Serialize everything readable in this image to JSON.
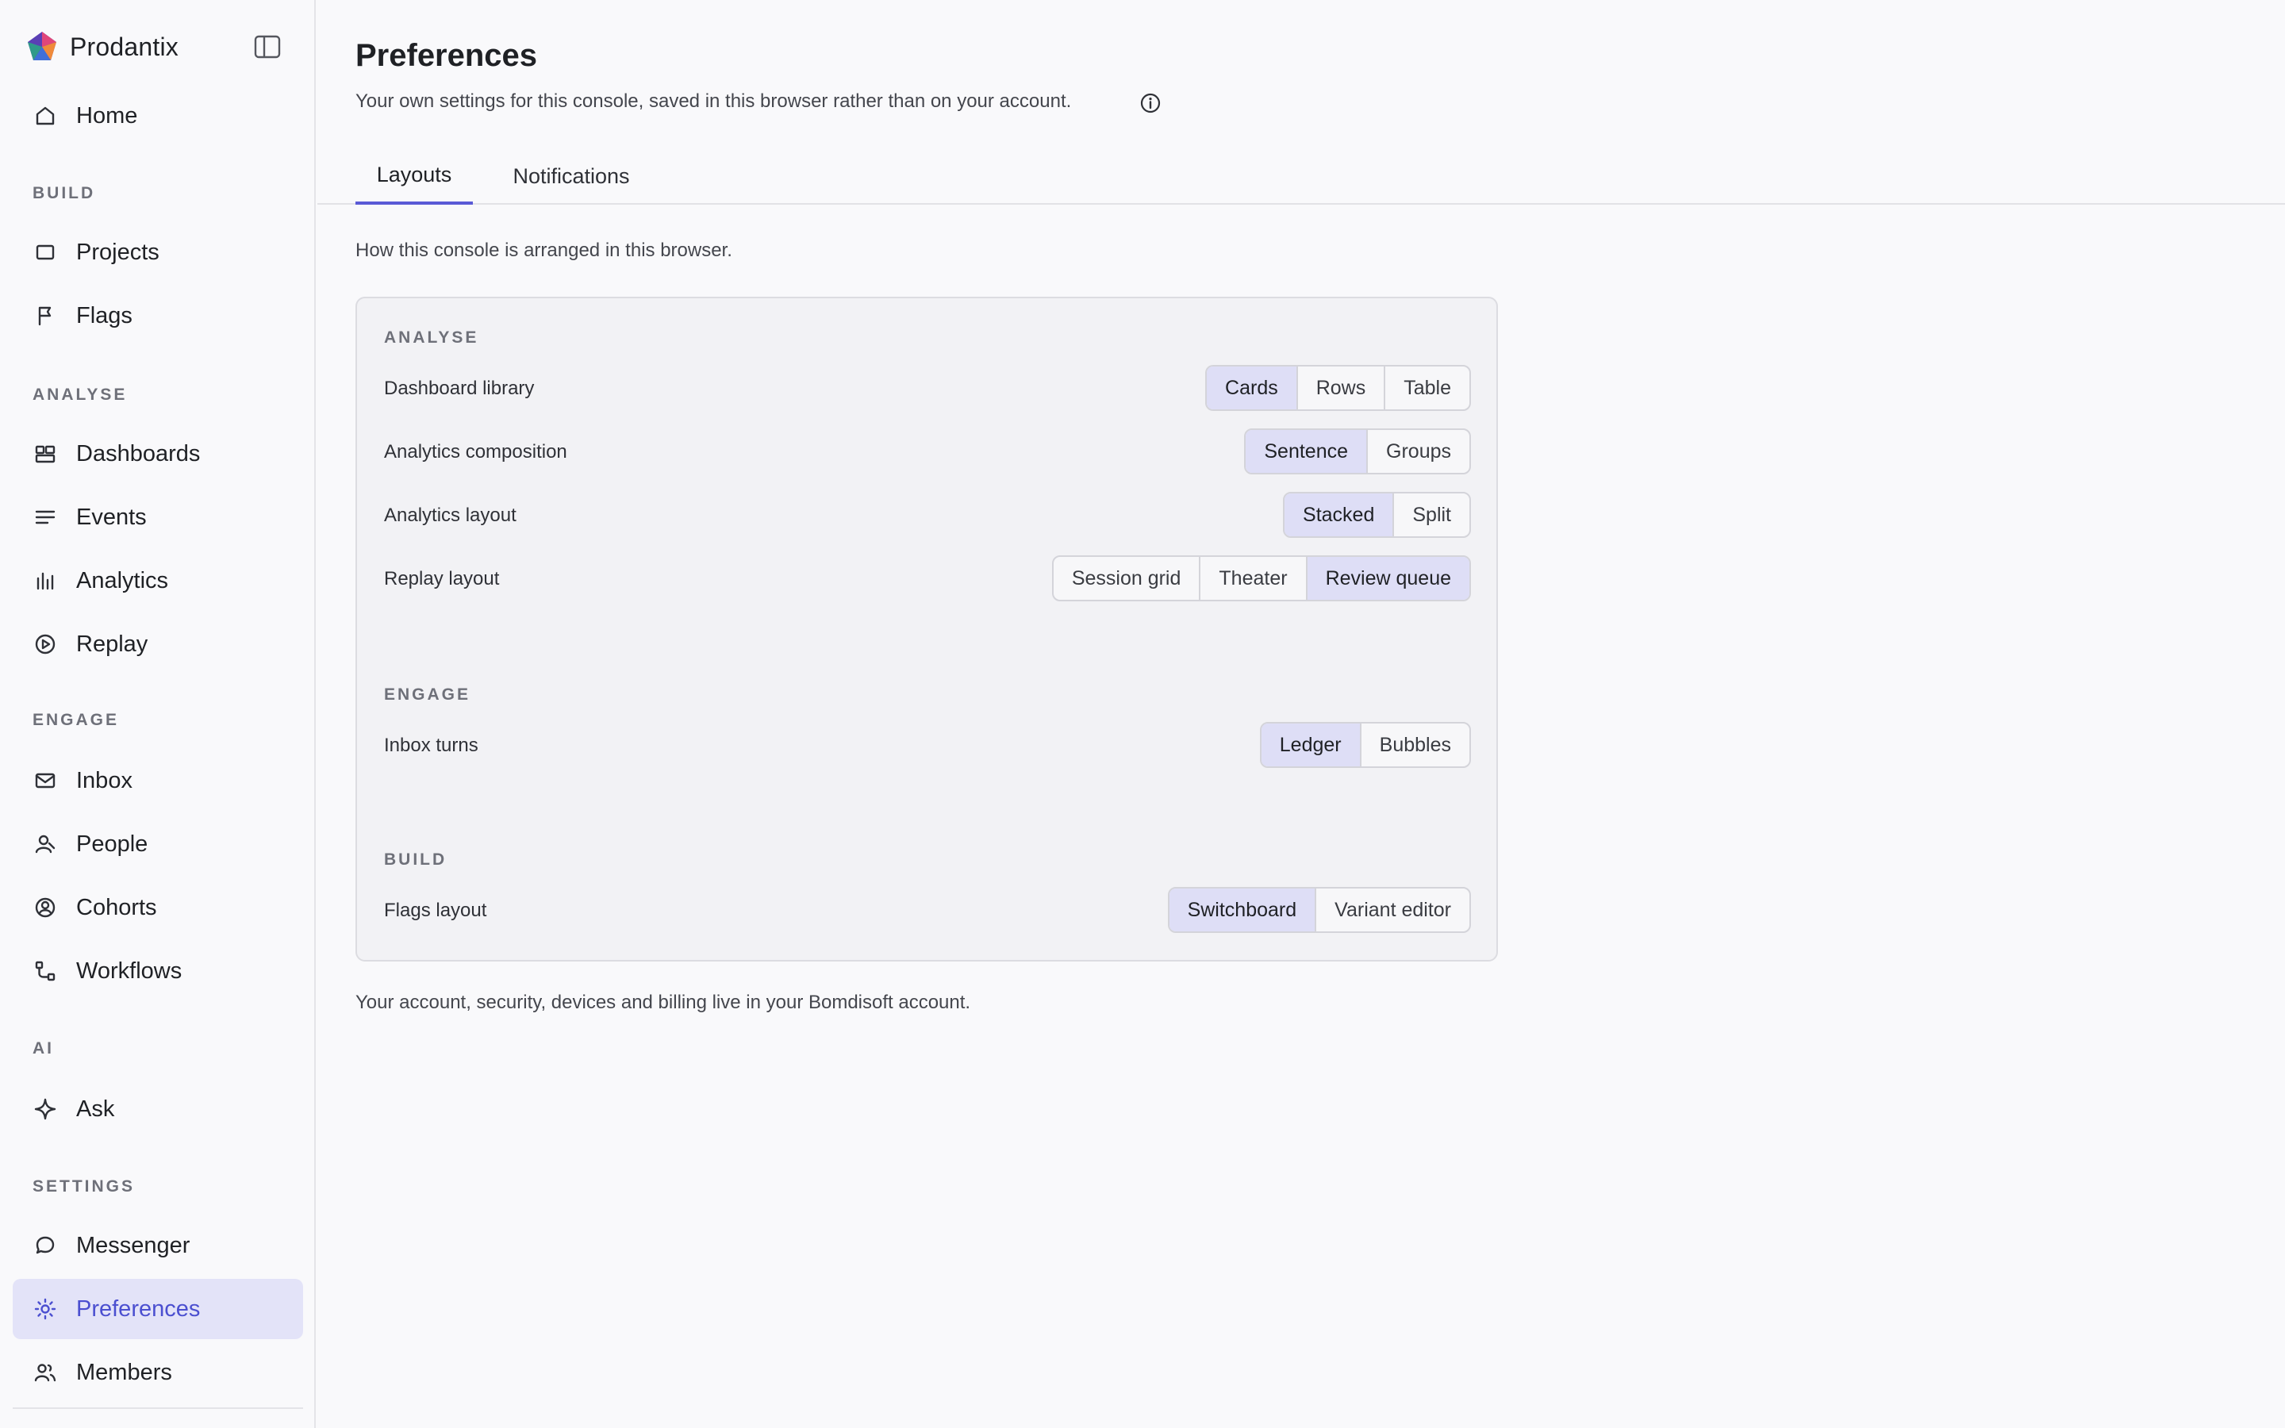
{
  "brand": {
    "name": "Prodantix"
  },
  "sidebar": {
    "home": {
      "label": "Home",
      "icon": "home-icon"
    },
    "sections": [
      {
        "label": "BUILD",
        "items": [
          {
            "label": "Projects",
            "icon": "square-icon"
          },
          {
            "label": "Flags",
            "icon": "flag-icon"
          }
        ]
      },
      {
        "label": "ANALYSE",
        "items": [
          {
            "label": "Dashboards",
            "icon": "dashboard-icon"
          },
          {
            "label": "Events",
            "icon": "list-lines-icon"
          },
          {
            "label": "Analytics",
            "icon": "bar-chart-icon"
          },
          {
            "label": "Replay",
            "icon": "play-circle-icon"
          }
        ]
      },
      {
        "label": "ENGAGE",
        "items": [
          {
            "label": "Inbox",
            "icon": "mail-icon"
          },
          {
            "label": "People",
            "icon": "person-icon"
          },
          {
            "label": "Cohorts",
            "icon": "cohort-icon"
          },
          {
            "label": "Workflows",
            "icon": "workflow-icon"
          }
        ]
      },
      {
        "label": "AI",
        "items": [
          {
            "label": "Ask",
            "icon": "sparkle-icon"
          }
        ]
      },
      {
        "label": "SETTINGS",
        "items": [
          {
            "label": "Messenger",
            "icon": "chat-bubble-icon"
          },
          {
            "label": "Preferences",
            "icon": "sun-gear-icon",
            "active": true
          },
          {
            "label": "Members",
            "icon": "members-icon"
          }
        ]
      }
    ]
  },
  "page": {
    "title": "Preferences",
    "subtitle": "Your own settings for this console, saved in this browser rather than on your account.",
    "tabs": [
      {
        "label": "Layouts",
        "active": true
      },
      {
        "label": "Notifications",
        "active": false
      }
    ],
    "section_desc": "How this console is arranged in this browser.",
    "groups": [
      {
        "label": "ANALYSE",
        "rows": [
          {
            "label": "Dashboard library",
            "options": [
              "Cards",
              "Rows",
              "Table"
            ],
            "selected": "Cards"
          },
          {
            "label": "Analytics composition",
            "options": [
              "Sentence",
              "Groups"
            ],
            "selected": "Sentence"
          },
          {
            "label": "Analytics layout",
            "options": [
              "Stacked",
              "Split"
            ],
            "selected": "Stacked"
          },
          {
            "label": "Replay layout",
            "options": [
              "Session grid",
              "Theater",
              "Review queue"
            ],
            "selected": "Review queue"
          }
        ]
      },
      {
        "label": "ENGAGE",
        "rows": [
          {
            "label": "Inbox turns",
            "options": [
              "Ledger",
              "Bubbles"
            ],
            "selected": "Ledger"
          }
        ]
      },
      {
        "label": "BUILD",
        "rows": [
          {
            "label": "Flags layout",
            "options": [
              "Switchboard",
              "Variant editor"
            ],
            "selected": "Switchboard"
          }
        ]
      }
    ],
    "footer": "Your account, security, devices and billing live in your Bomdisoft account."
  },
  "colors": {
    "accent": "#4b4fd0",
    "active_nav_bg": "#e3e3f8",
    "selected_segment_bg": "#dedef6"
  }
}
